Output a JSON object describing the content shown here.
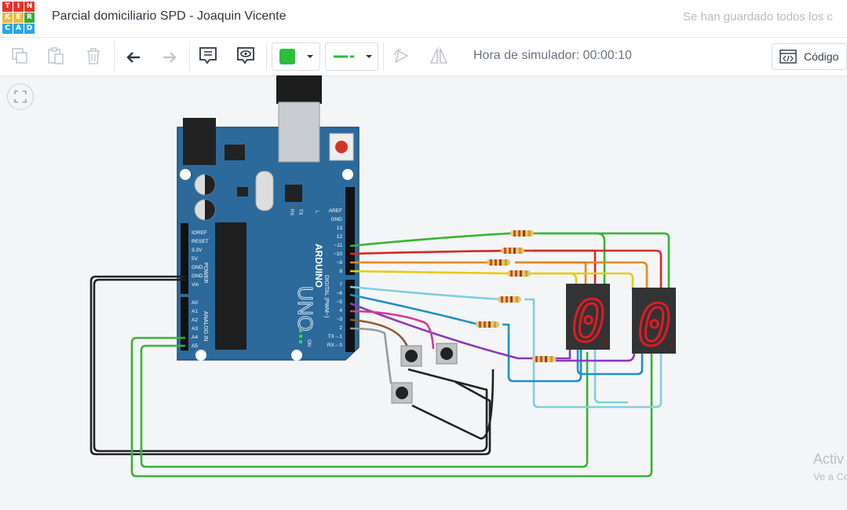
{
  "app": {
    "logo_letters": [
      "T",
      "I",
      "N",
      "K",
      "E",
      "R",
      "C",
      "A",
      "D"
    ],
    "logo_colors": [
      "#e6332a",
      "#f0b93a",
      "#28a7e1",
      "#3aa935"
    ],
    "project_title": "Parcial domiciliario SPD - Joaquin Vicente",
    "save_status": "Se han guardado todos los c"
  },
  "toolbar": {
    "copy_icon": "copy-icon",
    "paste_icon": "paste-icon",
    "delete_icon": "trash-icon",
    "undo_icon": "undo-icon",
    "redo_icon": "redo-icon",
    "notes_icon": "notes-icon",
    "view_icon": "eye-icon",
    "wire_color": "#2ebd3d",
    "wire_type_color": "#2ebd3d",
    "rotate_icon": "rotate-icon",
    "flip_icon": "flip-icon",
    "sim_time": "Hora de simulador: 00:00:10",
    "code_label": "Código"
  },
  "canvas": {
    "arduino": {
      "brand": "ARDUINO",
      "model": "UNO",
      "power_label": "POWER",
      "analog_label": "ANALOG IN",
      "digital_label": "DIGITAL (PWM~)",
      "on_label": "ON",
      "tx_label": "TX",
      "rx_label": "RX",
      "l_label": "L",
      "power_pins": [
        "IOREF",
        "RESET",
        "3.3V",
        "5V",
        "GND",
        "GND",
        "Vin"
      ],
      "analog_pins": [
        "A0",
        "A1",
        "A2",
        "A3",
        "A4",
        "A5"
      ],
      "digital_top_pins": [
        "AREF",
        "GND",
        "13",
        "12",
        "~11",
        "~10",
        "~9",
        "8"
      ],
      "digital_bottom_pins": [
        "7",
        "~6",
        "~5",
        "4",
        "~3",
        "2",
        "TX→1",
        "RX←0"
      ]
    },
    "displays": [
      {
        "digit": "0"
      },
      {
        "digit": "0"
      }
    ],
    "watermark_line1": "Activ",
    "watermark_line2": "Ve a Co"
  }
}
